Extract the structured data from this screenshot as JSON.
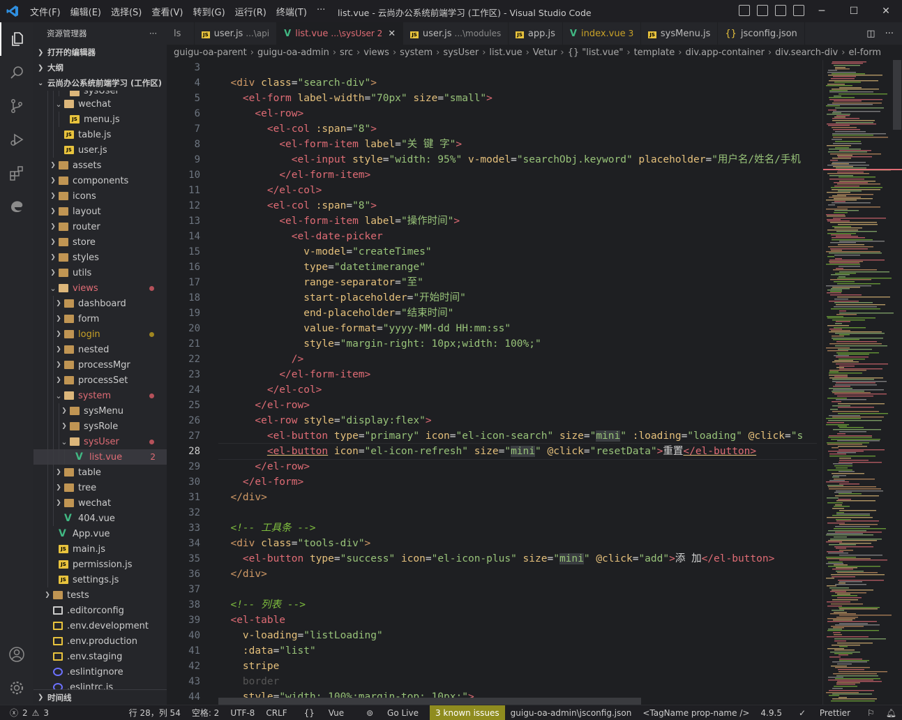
{
  "app": {
    "window_title": "list.vue - 云尚办公系统前端学习 (工作区) - Visual Studio Code",
    "menu": [
      "文件(F)",
      "编辑(E)",
      "选择(S)",
      "查看(V)",
      "转到(G)",
      "运行(R)",
      "终端(T)",
      "···"
    ]
  },
  "sidebar": {
    "title": "资源管理器",
    "more": "···",
    "sections": {
      "open_editors": "打开的编辑器",
      "outline": "大纲",
      "workspace": "云尚办公系统前端学习 (工作区)",
      "timeline": "时间线"
    },
    "tree": [
      {
        "label": "sysUser",
        "depth": 4,
        "type": "folder-open",
        "chev": "",
        "partial": true
      },
      {
        "label": "wechat",
        "depth": 3,
        "type": "folder-open",
        "chev": "v"
      },
      {
        "label": "menu.js",
        "depth": 4,
        "type": "js",
        "chev": ""
      },
      {
        "label": "table.js",
        "depth": 3,
        "type": "js",
        "chev": ""
      },
      {
        "label": "user.js",
        "depth": 3,
        "type": "js",
        "chev": ""
      },
      {
        "label": "assets",
        "depth": 2,
        "type": "folder",
        "chev": ">"
      },
      {
        "label": "components",
        "depth": 2,
        "type": "folder",
        "chev": ">"
      },
      {
        "label": "icons",
        "depth": 2,
        "type": "folder",
        "chev": ">"
      },
      {
        "label": "layout",
        "depth": 2,
        "type": "folder",
        "chev": ">"
      },
      {
        "label": "router",
        "depth": 2,
        "type": "folder",
        "chev": ">"
      },
      {
        "label": "store",
        "depth": 2,
        "type": "folder",
        "chev": ">"
      },
      {
        "label": "styles",
        "depth": 2,
        "type": "folder",
        "chev": ">"
      },
      {
        "label": "utils",
        "depth": 2,
        "type": "folder",
        "chev": ">"
      },
      {
        "label": "views",
        "depth": 2,
        "type": "folder-open",
        "chev": "v",
        "status": "error"
      },
      {
        "label": "dashboard",
        "depth": 3,
        "type": "folder",
        "chev": ">"
      },
      {
        "label": "form",
        "depth": 3,
        "type": "folder",
        "chev": ">"
      },
      {
        "label": "login",
        "depth": 3,
        "type": "folder",
        "chev": ">",
        "status": "warn"
      },
      {
        "label": "nested",
        "depth": 3,
        "type": "folder",
        "chev": ">"
      },
      {
        "label": "processMgr",
        "depth": 3,
        "type": "folder",
        "chev": ">"
      },
      {
        "label": "processSet",
        "depth": 3,
        "type": "folder",
        "chev": ">"
      },
      {
        "label": "system",
        "depth": 3,
        "type": "folder-open",
        "chev": "v",
        "status": "error"
      },
      {
        "label": "sysMenu",
        "depth": 4,
        "type": "folder",
        "chev": ">"
      },
      {
        "label": "sysRole",
        "depth": 4,
        "type": "folder",
        "chev": ">"
      },
      {
        "label": "sysUser",
        "depth": 4,
        "type": "folder-open",
        "chev": "v",
        "status": "error"
      },
      {
        "label": "list.vue",
        "depth": 5,
        "type": "vue",
        "chev": "",
        "status": "error",
        "count": "2",
        "selected": true
      },
      {
        "label": "table",
        "depth": 3,
        "type": "folder",
        "chev": ">"
      },
      {
        "label": "tree",
        "depth": 3,
        "type": "folder",
        "chev": ">"
      },
      {
        "label": "wechat",
        "depth": 3,
        "type": "folder",
        "chev": ">"
      },
      {
        "label": "404.vue",
        "depth": 3,
        "type": "vue",
        "chev": ""
      },
      {
        "label": "App.vue",
        "depth": 2,
        "type": "vue",
        "chev": ""
      },
      {
        "label": "main.js",
        "depth": 2,
        "type": "js",
        "chev": ""
      },
      {
        "label": "permission.js",
        "depth": 2,
        "type": "js",
        "chev": ""
      },
      {
        "label": "settings.js",
        "depth": 2,
        "type": "js",
        "chev": ""
      },
      {
        "label": "tests",
        "depth": 1,
        "type": "folder",
        "chev": ">"
      },
      {
        "label": ".editorconfig",
        "depth": 1,
        "type": "config",
        "chev": ""
      },
      {
        "label": ".env.development",
        "depth": 1,
        "type": "env",
        "chev": ""
      },
      {
        "label": ".env.production",
        "depth": 1,
        "type": "env",
        "chev": ""
      },
      {
        "label": ".env.staging",
        "depth": 1,
        "type": "env",
        "chev": ""
      },
      {
        "label": ".eslintignore",
        "depth": 1,
        "type": "eslint",
        "chev": ""
      },
      {
        "label": ".eslintrc.js",
        "depth": 1,
        "type": "eslint",
        "chev": ""
      }
    ]
  },
  "tabs": [
    {
      "label": "ls",
      "hint": "",
      "icon": "",
      "active": false
    },
    {
      "label": "user.js",
      "hint": "...\\api",
      "icon": "js",
      "active": false
    },
    {
      "label": "list.vue",
      "hint": "...\\sysUser 2",
      "icon": "vue",
      "active": true
    },
    {
      "label": "user.js",
      "hint": "...\\modules",
      "icon": "js",
      "active": false
    },
    {
      "label": "app.js",
      "hint": "",
      "icon": "js",
      "active": false
    },
    {
      "label": "index.vue",
      "hint": "3",
      "icon": "vue",
      "active": false
    },
    {
      "label": "sysMenu.js",
      "hint": "",
      "icon": "js",
      "active": false
    },
    {
      "label": "jsconfig.json",
      "hint": "",
      "icon": "json",
      "active": false
    }
  ],
  "breadcrumb": [
    "guigu-oa-parent",
    "guigu-oa-admin",
    "src",
    "views",
    "system",
    "sysUser",
    "list.vue",
    "Vetur",
    "{} \"list.vue\"",
    "template",
    "div.app-container",
    "div.search-div",
    "el-form"
  ],
  "editor": {
    "first_line": 3,
    "current_line": 28
  },
  "status": {
    "errors": "2",
    "warnings": "3",
    "position": "行 28，列 54",
    "spaces": "空格: 2",
    "encoding": "UTF-8",
    "eol": "CRLF",
    "language": "Vue",
    "golive": "Go Live",
    "known_issues": "3 known issues",
    "jsconfig": "guigu-oa-admin\\jsconfig.json",
    "tagname": "<TagName prop-name />",
    "version": "4.9.5",
    "prettier": "Prettier"
  },
  "colors": {
    "accent": "#2f8fe0",
    "error": "#e06c75",
    "warning": "#c9a227",
    "known_issues_bg": "#8f8c1f"
  }
}
